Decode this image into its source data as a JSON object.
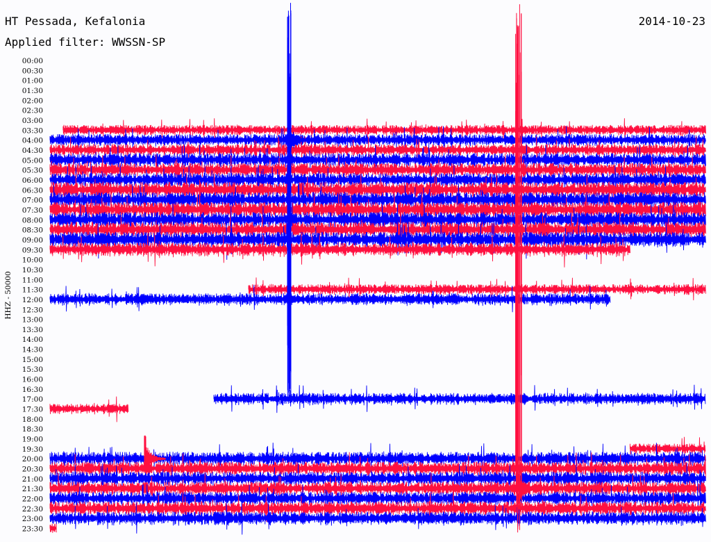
{
  "header": {
    "station": "HT Pessada, Kefalonia",
    "filter": "Applied filter: WWSSN-SP",
    "date": "2014-10-23"
  },
  "chart_data": {
    "type": "helicorder",
    "title": "HT Pessada, Kefalonia",
    "subtitle": "Applied filter: WWSSN-SP",
    "date": "2014-10-23",
    "ylabel": "HHZ - 50000",
    "time_labels": [
      "00:00",
      "00:30",
      "01:00",
      "01:30",
      "02:00",
      "02:30",
      "03:00",
      "03:30",
      "04:00",
      "04:30",
      "05:00",
      "05:30",
      "06:00",
      "06:30",
      "07:00",
      "07:30",
      "08:00",
      "08:30",
      "09:00",
      "09:30",
      "10:00",
      "10:30",
      "11:00",
      "11:30",
      "12:00",
      "12:30",
      "13:00",
      "13:30",
      "14:00",
      "14:30",
      "15:00",
      "15:30",
      "16:00",
      "16:30",
      "17:00",
      "17:30",
      "18:00",
      "18:30",
      "19:00",
      "19:30",
      "20:00",
      "20:30",
      "21:00",
      "21:30",
      "22:00",
      "22:30",
      "23:00",
      "23:30"
    ],
    "colors": {
      "odd_rows": "#ff1040",
      "even_rows": "#0000ff"
    },
    "trace_segments": [
      {
        "label": "03:30",
        "color": "#ff1040",
        "start": 0.02,
        "end": 1.0,
        "amp": 6
      },
      {
        "label": "04:00",
        "color": "#0000ff",
        "start": 0.0,
        "end": 1.0,
        "amp": 7
      },
      {
        "label": "04:30",
        "color": "#ff1040",
        "start": 0.0,
        "end": 1.0,
        "amp": 7
      },
      {
        "label": "05:00",
        "color": "#0000ff",
        "start": 0.0,
        "end": 1.0,
        "amp": 8
      },
      {
        "label": "05:30",
        "color": "#ff1040",
        "start": 0.0,
        "end": 1.0,
        "amp": 8
      },
      {
        "label": "06:00",
        "color": "#0000ff",
        "start": 0.0,
        "end": 1.0,
        "amp": 8
      },
      {
        "label": "06:30",
        "color": "#ff1040",
        "start": 0.0,
        "end": 1.0,
        "amp": 9
      },
      {
        "label": "07:00",
        "color": "#0000ff",
        "start": 0.0,
        "end": 1.0,
        "amp": 9
      },
      {
        "label": "07:30",
        "color": "#ff1040",
        "start": 0.0,
        "end": 1.0,
        "amp": 9
      },
      {
        "label": "08:00",
        "color": "#0000ff",
        "start": 0.0,
        "end": 1.0,
        "amp": 9
      },
      {
        "label": "08:30",
        "color": "#ff1040",
        "start": 0.0,
        "end": 1.0,
        "amp": 9
      },
      {
        "label": "09:00",
        "color": "#0000ff",
        "start": 0.0,
        "end": 1.0,
        "amp": 9
      },
      {
        "label": "09:30",
        "color": "#ff1040",
        "start": 0.0,
        "end": 0.885,
        "amp": 8
      },
      {
        "label": "11:30",
        "color": "#ff1040",
        "start": 0.303,
        "end": 1.0,
        "amp": 6
      },
      {
        "label": "12:00",
        "color": "#0000ff",
        "start": 0.0,
        "end": 0.855,
        "amp": 7
      },
      {
        "label": "17:00",
        "color": "#0000ff",
        "start": 0.25,
        "end": 1.0,
        "amp": 7
      },
      {
        "label": "17:30",
        "color": "#ff1040",
        "start": 0.0,
        "end": 0.12,
        "amp": 6
      },
      {
        "label": "19:30",
        "color": "#ff1040",
        "start": 0.885,
        "end": 1.0,
        "amp": 6
      },
      {
        "label": "20:00",
        "color": "#0000ff",
        "start": 0.0,
        "end": 1.0,
        "amp": 8
      },
      {
        "label": "20:30",
        "color": "#ff1040",
        "start": 0.0,
        "end": 1.0,
        "amp": 8
      },
      {
        "label": "21:00",
        "color": "#0000ff",
        "start": 0.0,
        "end": 1.0,
        "amp": 8
      },
      {
        "label": "21:30",
        "color": "#ff1040",
        "start": 0.0,
        "end": 1.0,
        "amp": 8
      },
      {
        "label": "22:00",
        "color": "#0000ff",
        "start": 0.0,
        "end": 1.0,
        "amp": 8
      },
      {
        "label": "22:30",
        "color": "#ff1040",
        "start": 0.0,
        "end": 1.0,
        "amp": 8
      },
      {
        "label": "23:00",
        "color": "#0000ff",
        "start": 0.0,
        "end": 1.0,
        "amp": 8
      },
      {
        "label": "23:30",
        "color": "#ff1040",
        "start": 0.0,
        "end": 0.01,
        "amp": 6
      }
    ],
    "events": [
      {
        "color": "#0000ff",
        "position": 0.365,
        "label": "04:00",
        "top_label": "00:00",
        "bottom_label": "17:00"
      },
      {
        "color": "#ff1040",
        "position": 0.715,
        "label": "21:30",
        "top_label": "00:00",
        "bottom_label": "23:30"
      },
      {
        "color": "#ff1040",
        "position": 0.145,
        "label": "20:00",
        "top_label": "19:00",
        "bottom_label": "20:00"
      }
    ]
  }
}
